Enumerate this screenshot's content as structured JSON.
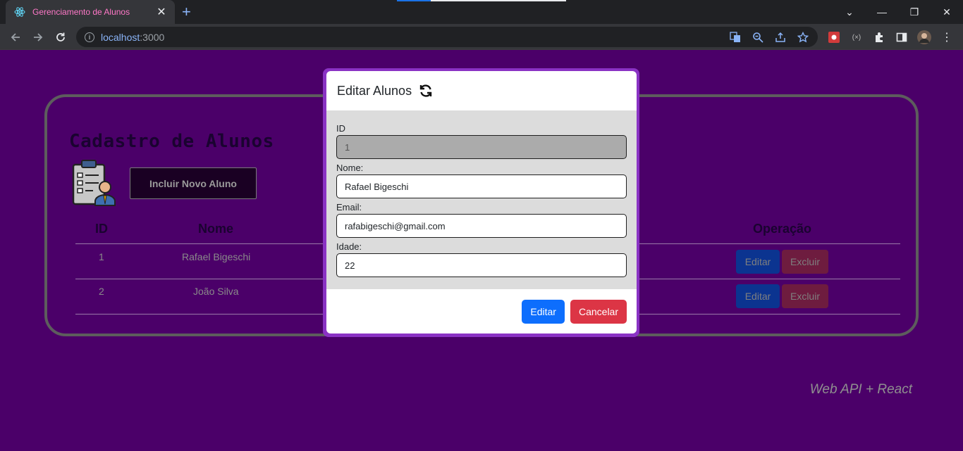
{
  "browser": {
    "tab_title": "Gerenciamento de Alunos",
    "tab_close": "✕",
    "new_tab": "+",
    "url_host": "localhost",
    "url_port": ":3000",
    "window_controls": {
      "minimize": "—",
      "restore": "❐",
      "close": "✕",
      "tab_search": "⌄"
    }
  },
  "page": {
    "title": "Cadastro de Alunos",
    "new_button": "Incluir Novo Aluno",
    "table": {
      "headers": {
        "id": "ID",
        "nome": "Nome",
        "operacao": "Operação"
      },
      "rows": [
        {
          "id": "1",
          "nome": "Rafael Bigeschi",
          "edit": "Editar",
          "delete": "Excluir"
        },
        {
          "id": "2",
          "nome": "João Silva",
          "edit": "Editar",
          "delete": "Excluir"
        }
      ]
    },
    "footer": "Web API + React"
  },
  "modal": {
    "title": "Editar Alunos",
    "fields": {
      "id": {
        "label": "ID",
        "value": "1"
      },
      "nome": {
        "label": "Nome:",
        "value": "Rafael Bigeschi"
      },
      "email": {
        "label": "Email:",
        "value": "rafabigeschi@gmail.com"
      },
      "idade": {
        "label": "Idade:",
        "value": "22"
      }
    },
    "edit_button": "Editar",
    "cancel_button": "Cancelar"
  },
  "colors": {
    "page_bg": "#4b0069",
    "modal_border": "#8a32c4",
    "primary": "#0d6efd",
    "danger": "#dc3545"
  }
}
